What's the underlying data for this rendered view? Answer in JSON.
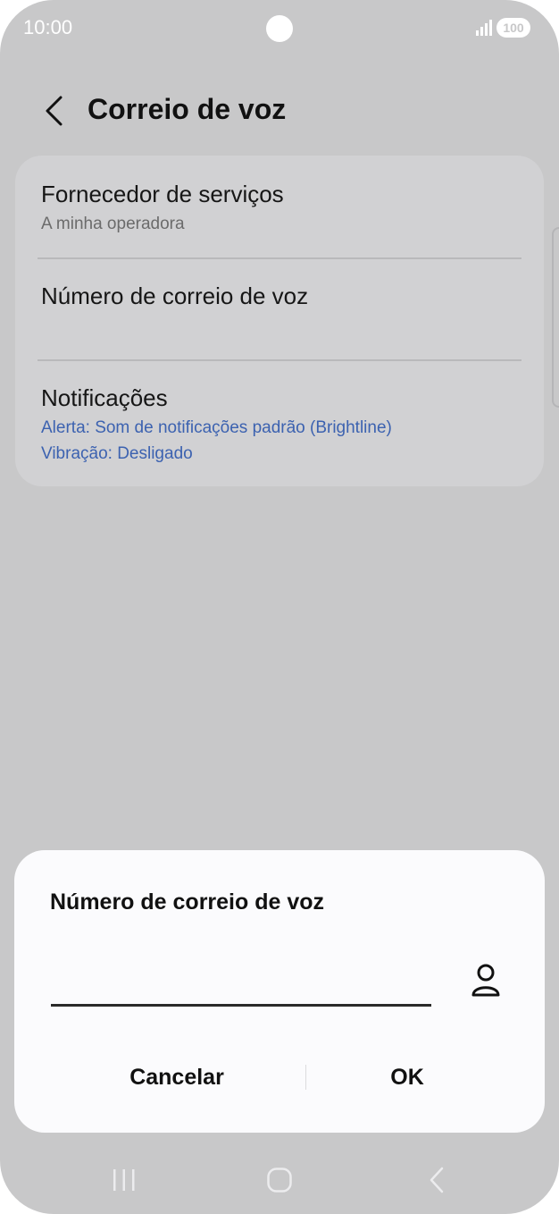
{
  "status_bar": {
    "time": "10:00",
    "battery": "100",
    "icons": [
      "camera-cutout",
      "signal-icon",
      "battery-icon"
    ]
  },
  "header": {
    "back_icon": "chevron-left-icon",
    "title": "Correio de voz"
  },
  "settings": {
    "provider": {
      "title": "Fornecedor de serviços",
      "subtitle": "A minha operadora"
    },
    "voicemail_number": {
      "title": "Número de correio de voz"
    },
    "notifications": {
      "title": "Notificações",
      "alert": "Alerta: Som de notificações padrão (Brightline)",
      "vibration": "Vibração: Desligado"
    }
  },
  "dialog": {
    "title": "Número de correio de voz",
    "input_value": "",
    "contact_icon": "person-icon",
    "cancel_label": "Cancelar",
    "ok_label": "OK"
  },
  "nav_bar": {
    "icons": [
      "recent-apps-icon",
      "home-icon",
      "back-icon"
    ]
  },
  "colors": {
    "background_dim": "#c8c8c9",
    "card": "#d1d1d3",
    "dialog": "#fbfbfd",
    "link_blue": "#3c62b0"
  }
}
